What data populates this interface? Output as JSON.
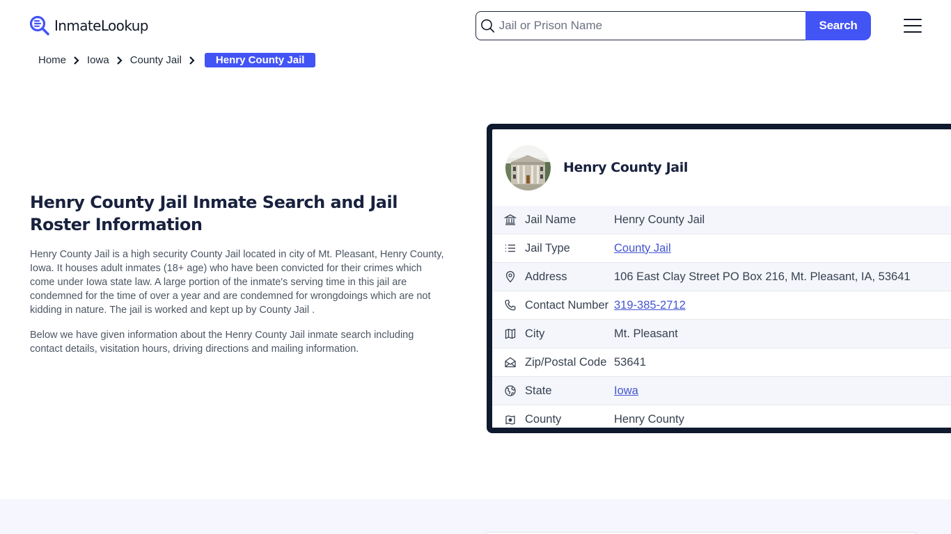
{
  "header": {
    "logo_text": "InmateLookup",
    "search": {
      "placeholder": "Jail or Prison Name",
      "value": "",
      "button_label": "Search"
    },
    "brand_color": "#4354f5"
  },
  "breadcrumb": [
    {
      "label": "Home"
    },
    {
      "label": "Iowa"
    },
    {
      "label": "County Jail"
    },
    {
      "label": "Henry County Jail",
      "active": true
    }
  ],
  "main": {
    "title": "Henry County Jail Inmate Search and Jail Roster Information",
    "paragraphs": [
      "Henry County Jail is a high security County Jail located in city of Mt. Pleasant, Henry County, Iowa. It houses adult inmates (18+ age) who have been convicted for their crimes which come under Iowa state law. A large portion of the inmate's serving time in this jail are condemned for the time of over a year and are condemned for wrongdoings which are not kidding in nature. The jail is worked and kept up by County Jail .",
      "Below we have given information about the Henry County Jail inmate search including contact details, visitation hours, driving directions and mailing information."
    ]
  },
  "card": {
    "title": "Henry County Jail",
    "avatar_alt": "Henry County Jail building photo",
    "rows": [
      {
        "icon": "building-columns-icon",
        "label": "Jail Name",
        "value": "Henry County Jail",
        "link": false
      },
      {
        "icon": "list-icon",
        "label": "Jail Type",
        "value": "County Jail",
        "link": true
      },
      {
        "icon": "map-pin-icon",
        "label": "Address",
        "value": "106 East Clay Street PO Box 216, Mt. Pleasant, IA, 53641",
        "link": false
      },
      {
        "icon": "phone-icon",
        "label": "Contact Number",
        "value": "319-385-2712",
        "link": true
      },
      {
        "icon": "map-icon",
        "label": "City",
        "value": "Mt. Pleasant",
        "link": false
      },
      {
        "icon": "mail-open-icon",
        "label": "Zip/Postal Code",
        "value": "53641",
        "link": false
      },
      {
        "icon": "globe-icon",
        "label": "State",
        "value": "Iowa",
        "link": true
      },
      {
        "icon": "county-map-icon",
        "label": "County",
        "value": "Henry County",
        "link": false
      }
    ]
  }
}
